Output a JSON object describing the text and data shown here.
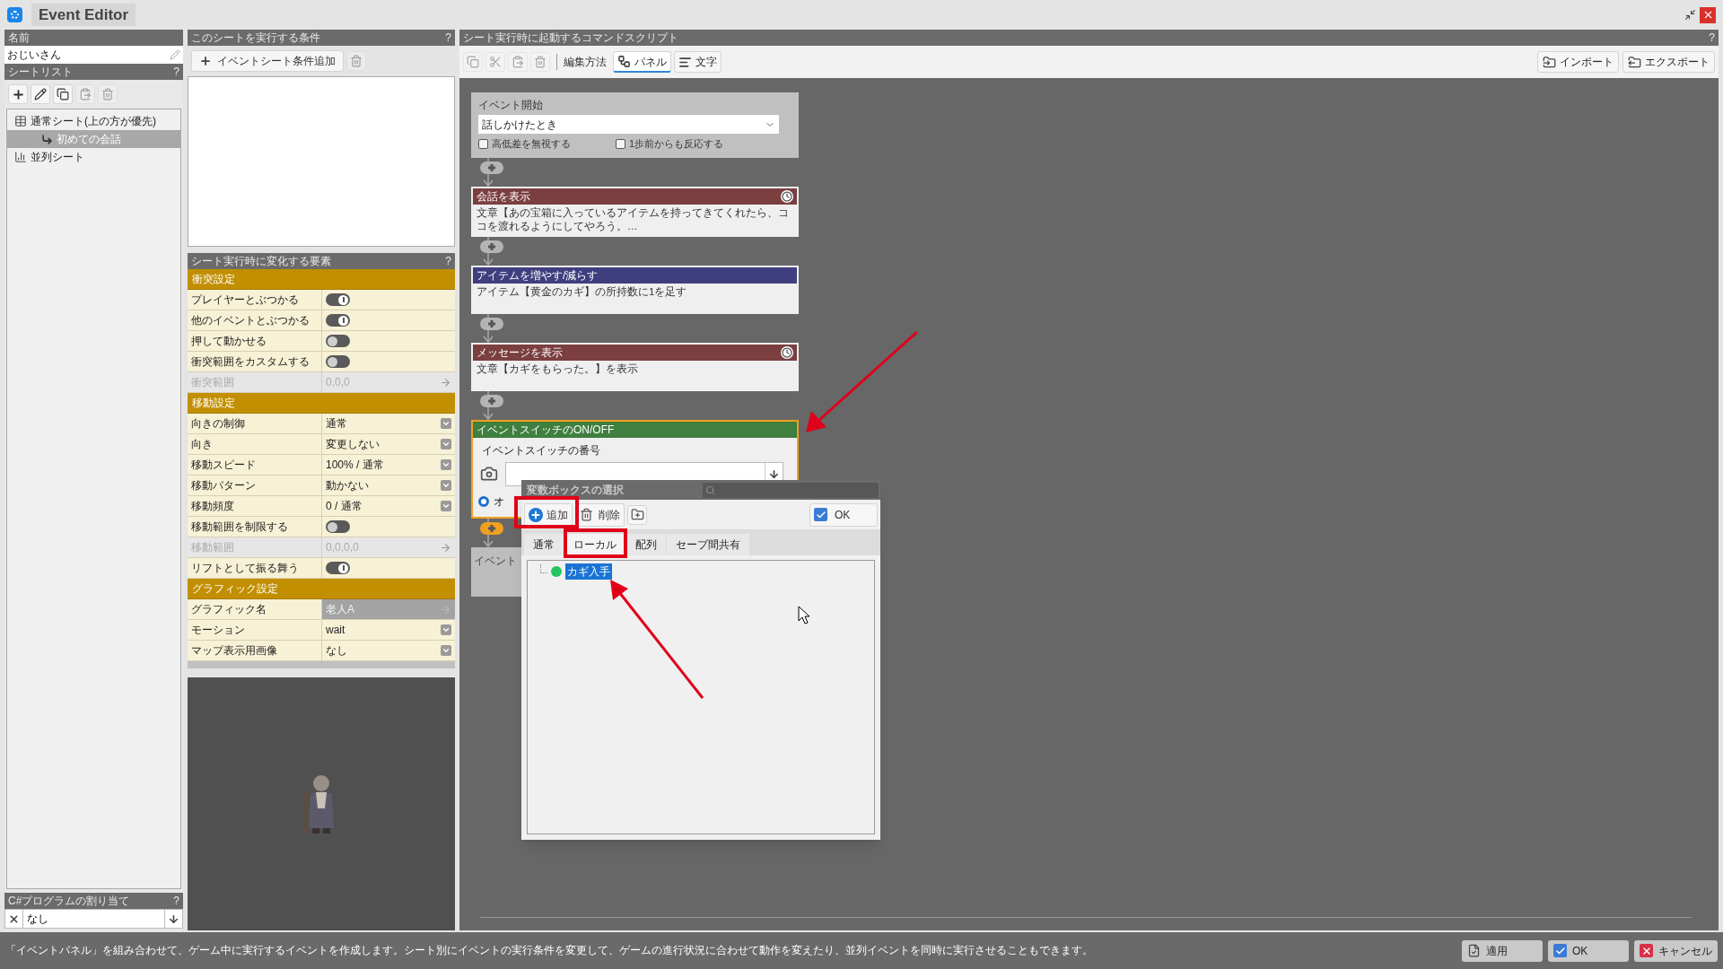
{
  "window": {
    "title": "Event Editor"
  },
  "left": {
    "name_header": "名前",
    "name_value": "おじいさん",
    "sheet_header": {
      "title": "シートリスト",
      "help": "?"
    },
    "tree": [
      {
        "label": "通常シート(上の方が優先)",
        "kind": "normal",
        "selected": false,
        "children": [
          {
            "label": "初めての会話",
            "selected": true
          }
        ]
      },
      {
        "label": "並列シート",
        "kind": "parallel",
        "selected": false
      }
    ],
    "csharp": {
      "title": "C#プログラムの割り当て",
      "help": "?",
      "value": "なし"
    }
  },
  "conditions": {
    "title": "このシートを実行する条件",
    "help": "?",
    "add_button": "イベントシート条件追加"
  },
  "properties": {
    "title": "シート実行時に変化する要素",
    "help": "?",
    "rows": [
      {
        "kind": "section",
        "label": "衝突設定"
      },
      {
        "kind": "toggle",
        "label": "プレイヤーとぶつかる",
        "on": true
      },
      {
        "kind": "toggle",
        "label": "他のイベントとぶつかる",
        "on": true
      },
      {
        "kind": "toggle",
        "label": "押して動かせる",
        "on": false
      },
      {
        "kind": "toggle",
        "label": "衝突範囲をカスタムする",
        "on": false
      },
      {
        "kind": "link",
        "label": "衝突範囲",
        "value": "0,0,0",
        "disabled": true
      },
      {
        "kind": "section",
        "label": "移動設定"
      },
      {
        "kind": "select",
        "label": "向きの制御",
        "value": "通常"
      },
      {
        "kind": "select",
        "label": "向き",
        "value": "変更しない"
      },
      {
        "kind": "select",
        "label": "移動スピード",
        "value": "100% / 通常"
      },
      {
        "kind": "select",
        "label": "移動パターン",
        "value": "動かない"
      },
      {
        "kind": "select",
        "label": "移動頻度",
        "value": "0 / 通常"
      },
      {
        "kind": "toggle",
        "label": "移動範囲を制限する",
        "on": false
      },
      {
        "kind": "link",
        "label": "移動範囲",
        "value": "0,0,0,0",
        "disabled": true
      },
      {
        "kind": "toggle",
        "label": "リフトとして振る舞う",
        "on": true
      },
      {
        "kind": "section",
        "label": "グラフィック設定"
      },
      {
        "kind": "link",
        "label": "グラフィック名",
        "value": "老人A",
        "disabled": false
      },
      {
        "kind": "select",
        "label": "モーション",
        "value": "wait"
      },
      {
        "kind": "select",
        "label": "マップ表示用画像",
        "value": "なし"
      }
    ]
  },
  "script": {
    "title": "シート実行時に起動するコマンドスクリプト",
    "help": "?",
    "edit_label": "編集方法",
    "modes": [
      {
        "label": "パネル",
        "kind": "panel",
        "selected": true
      },
      {
        "label": "文字",
        "kind": "text",
        "selected": false
      }
    ],
    "import": "インポート",
    "export": "エクスポート"
  },
  "panels": [
    {
      "kind": "start",
      "title": "イベント開始",
      "selected": false,
      "select": "話しかけたとき",
      "checks": [
        {
          "label": "高低差を無視する",
          "checked": false
        },
        {
          "label": "1歩前からも反応する",
          "checked": false
        }
      ]
    },
    {
      "kind": "command",
      "title": "会話を表示",
      "selected": false,
      "color": "#7b3f40",
      "timer": true,
      "body": "文章【あの宝箱に入っているアイテムを持ってきてくれたら、ココを渡れるようにしてやろう。…"
    },
    {
      "kind": "command",
      "title": "アイテムを増やす/減らす",
      "selected": false,
      "color": "#3f3f7f",
      "timer": false,
      "body": "アイテム【黄金のカギ】の所持数に1を足す"
    },
    {
      "kind": "command",
      "title": "メッセージを表示",
      "selected": false,
      "color": "#7b3f40",
      "timer": true,
      "body": "文章【カギをもらった。】を表示"
    },
    {
      "kind": "switch",
      "title": "イベントスイッチのON/OFF",
      "selected": true,
      "color": "#3f7f3f",
      "field_label": "イベントスイッチの番号",
      "radio": "オ",
      "radio_selected": true
    },
    {
      "kind": "partial",
      "title": "イベント",
      "selected": false
    }
  ],
  "connectors": [
    {
      "selected": false
    },
    {
      "selected": false
    },
    {
      "selected": false
    },
    {
      "selected": false
    },
    {
      "selected": true
    }
  ],
  "popup": {
    "title": "変数ボックスの選択",
    "add": "追加",
    "delete": "削除",
    "ok": "OK",
    "tabs": [
      {
        "label": "通常",
        "selected": false
      },
      {
        "label": "ローカル",
        "selected": true
      },
      {
        "label": "配列",
        "selected": false
      },
      {
        "label": "セーブ間共有",
        "selected": false
      }
    ],
    "items": [
      {
        "label": "カギ入手",
        "selected": true,
        "color": "#22c55e"
      }
    ]
  },
  "status_text": "「イベントパネル」を組み合わせて、ゲーム中に実行するイベントを作成します。シート別にイベントの実行条件を変更して、ゲームの進行状況に合わせて動作を変えたり、並列イベントを同時に実行させることもできます。",
  "buttons": [
    {
      "label": "適用",
      "kind": "apply"
    },
    {
      "label": "OK",
      "kind": "ok"
    },
    {
      "label": "キャンセル",
      "kind": "cancel"
    }
  ]
}
